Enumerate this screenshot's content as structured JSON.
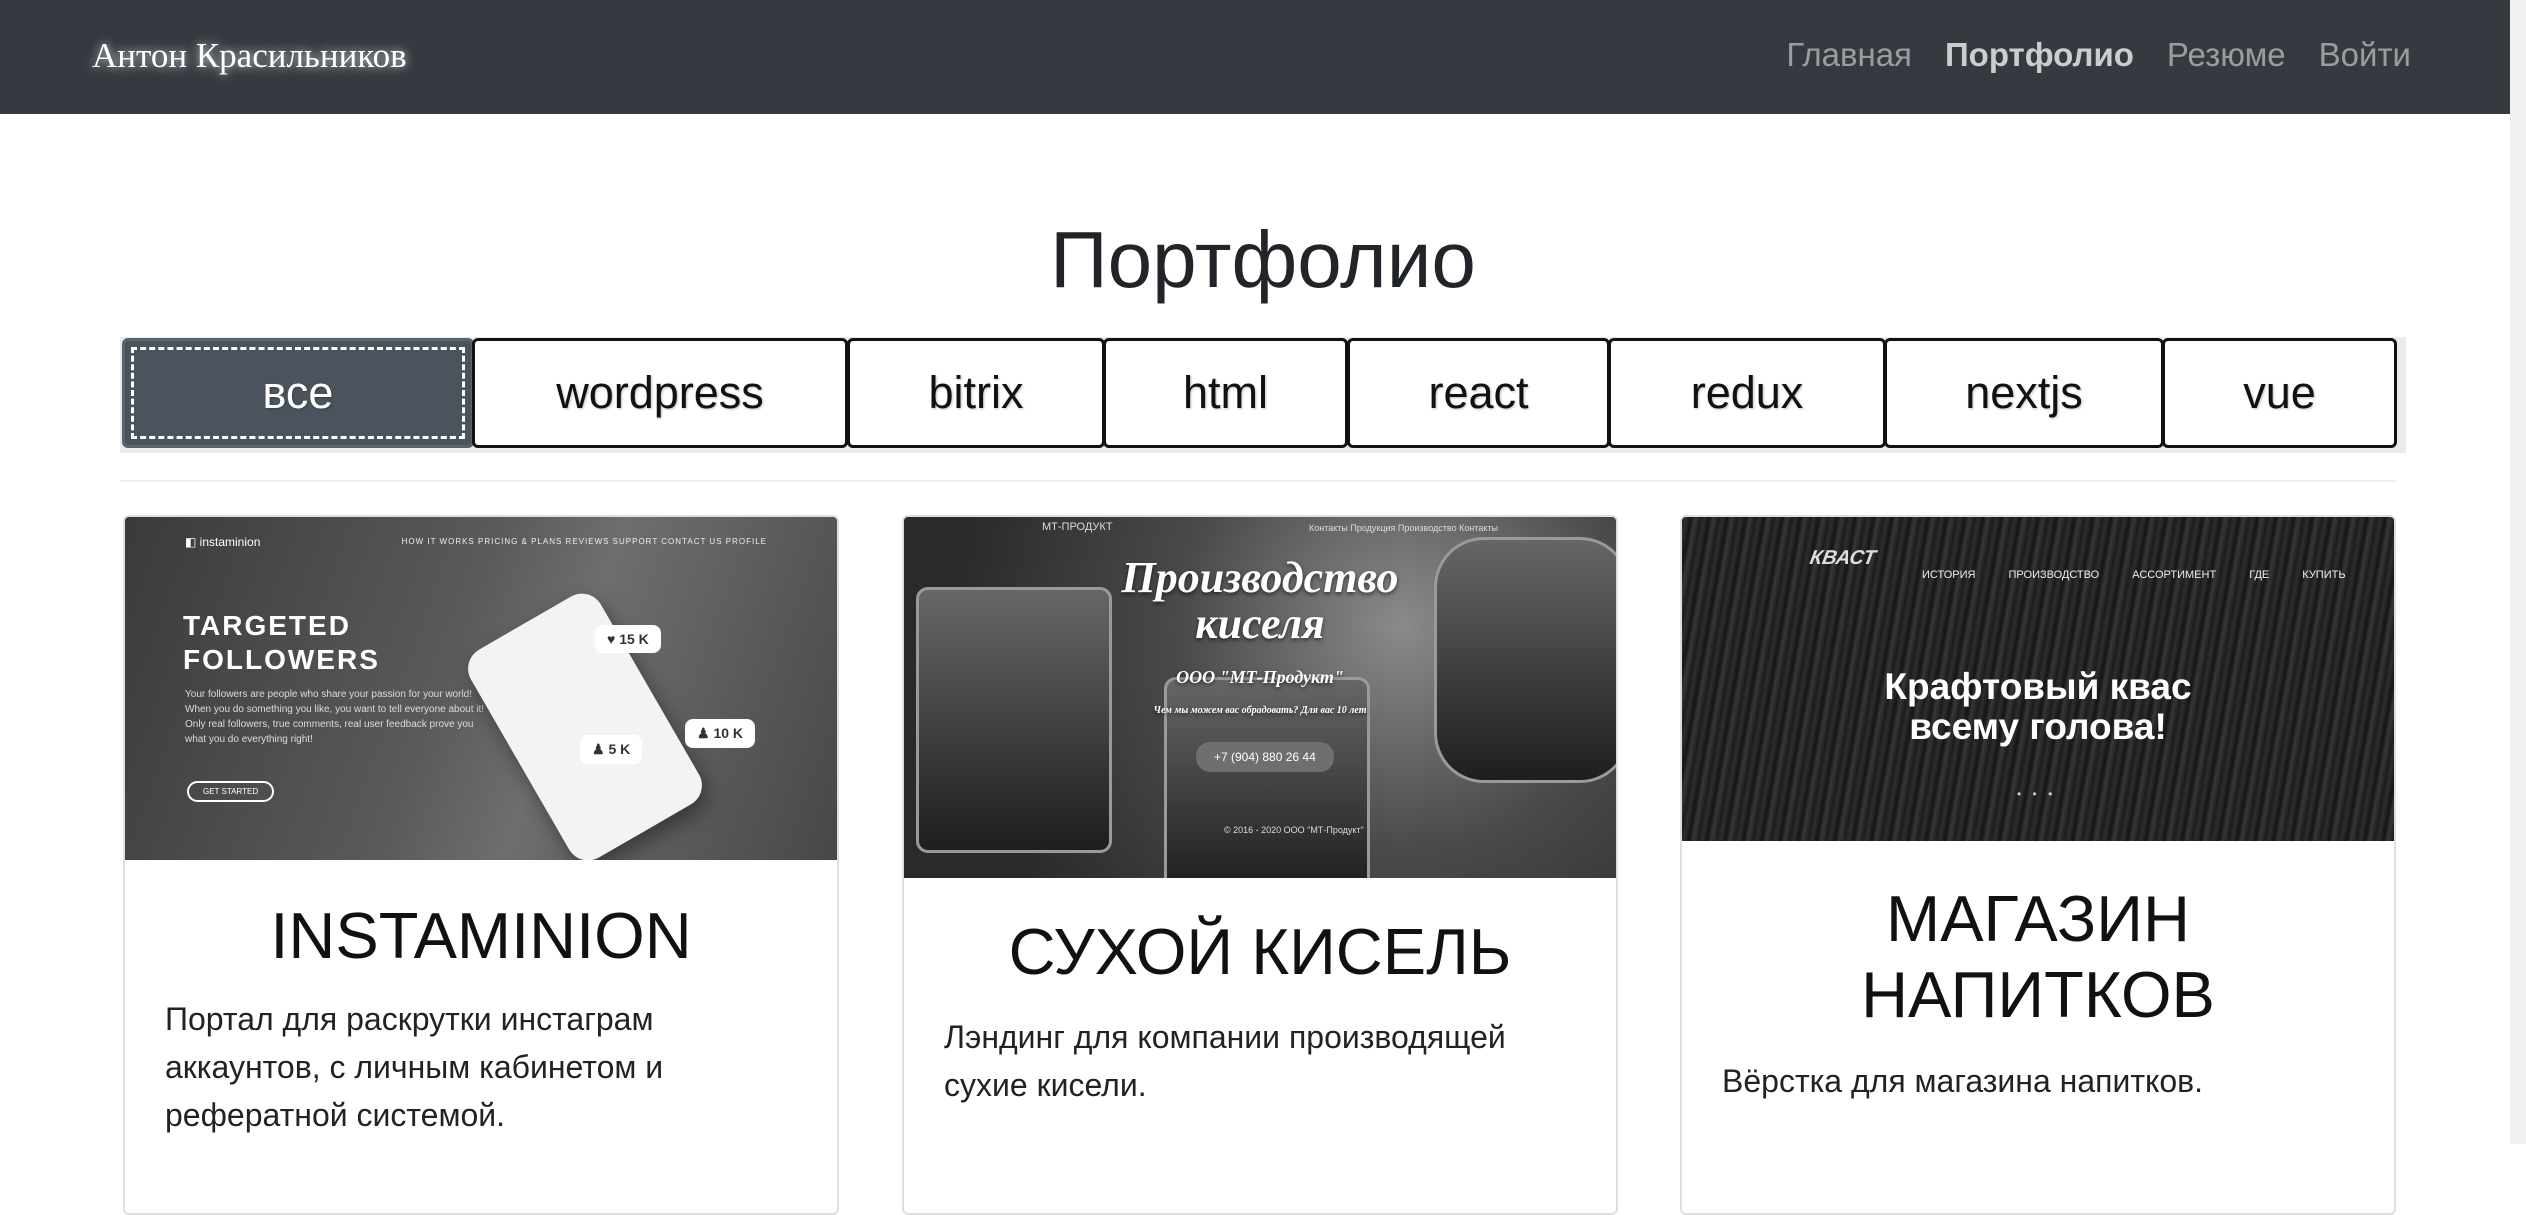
{
  "navbar": {
    "brand": "Антон Красильников",
    "links": [
      {
        "label": "Главная",
        "active": false
      },
      {
        "label": "Портфолио",
        "active": true
      },
      {
        "label": "Резюме",
        "active": false
      },
      {
        "label": "Войти",
        "active": false
      }
    ]
  },
  "page_title": "Портфолио",
  "filters": [
    {
      "label": "все",
      "active": true
    },
    {
      "label": "wordpress",
      "active": false
    },
    {
      "label": "bitrix",
      "active": false
    },
    {
      "label": "html",
      "active": false
    },
    {
      "label": "react",
      "active": false
    },
    {
      "label": "redux",
      "active": false
    },
    {
      "label": "nextjs",
      "active": false
    },
    {
      "label": "vue",
      "active": false
    }
  ],
  "cards": [
    {
      "title": "INSTAMINION",
      "text": "Портал для раскрутки инстаграм аккаунтов, с личным кабинетом и рефератной системой.",
      "preview": {
        "logo": "instaminion",
        "menu": "HOW IT WORKS   PRICING & PLANS   REVIEWS   SUPPORT   CONTACT US   PROFILE",
        "headline_1": "TARGETED",
        "headline_2": "FOLLOWERS",
        "subtext": "Your followers are people who share your passion for your world! When you do something you like, you want to tell everyone about it! Only real followers, true comments, real user feedback prove you what you do everything right!",
        "cta": "GET STARTED",
        "badge_1": "♥ 15 K",
        "badge_2": "♟ 5 K",
        "badge_3": "♟ 10 K"
      }
    },
    {
      "title": "СУХОЙ КИСЕЛЬ",
      "text": "Лэндинг для компании производящей сухие кисели.",
      "preview": {
        "logo": "МТ-ПРОДУКТ",
        "menu": "Контакты   Продукция   Производство   Контакты",
        "headline_1": "Производство",
        "headline_2": "киселя",
        "company": "ООО \"МТ-Продукт\"",
        "slogan": "Чем мы можем вас обрадовать? Для вас 10 лет",
        "phone": "+7 (904) 880 26 44",
        "footer": "© 2016 - 2020 ООО \"МТ-Продукт\""
      }
    },
    {
      "title": "МАГАЗИН НАПИТКОВ",
      "text": "Вёрстка для магазина напитков.",
      "preview": {
        "logo": "КВАСТ",
        "menu": "ИСТОРИЯ ПРОИЗВОДСТВО АССОРТИМЕНТ ГДЕ КУПИТЬ",
        "headline_1": "Крафтовый квас",
        "headline_2": "всему голова!",
        "dots": "• • •"
      }
    }
  ]
}
